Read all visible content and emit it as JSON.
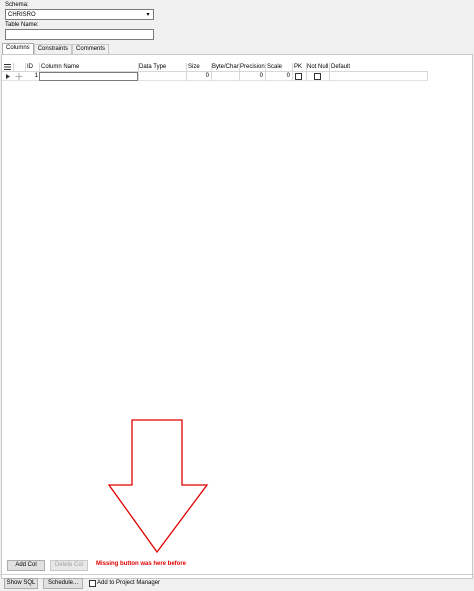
{
  "form": {
    "schema_label": "Schema:",
    "schema_value": "CHRISRO",
    "table_name_label": "Table Name:",
    "table_name_value": ""
  },
  "tabs": [
    {
      "label": "Columns",
      "active": true
    },
    {
      "label": "Constraints",
      "active": false
    },
    {
      "label": "Comments",
      "active": false
    }
  ],
  "grid": {
    "columns": [
      "ID",
      "Column Name",
      "Data Type",
      "Size",
      "Byte/Char",
      "Precision",
      "Scale",
      "PK",
      "Not Null",
      "Default"
    ],
    "rows": [
      {
        "id": "1",
        "column_name": "",
        "data_type": "",
        "size": "0",
        "byte_char": "",
        "precision": "0",
        "scale": "0",
        "pk": false,
        "not_null": false,
        "default": ""
      }
    ]
  },
  "buttons": {
    "add_col": "Add Col",
    "delete_col": "Delete Col",
    "show_sql": "Show SQL",
    "schedule": "Schedule..."
  },
  "annotation": {
    "note": "Missing button was here before",
    "arrow_color": "#e00000"
  },
  "footer": {
    "add_to_project_label": "Add to Project Manager",
    "add_to_project_checked": false
  },
  "icons": [
    "grid-menu-icon",
    "row-selector-icon",
    "drag-handle-icon",
    "combo-arrow-icon"
  ]
}
